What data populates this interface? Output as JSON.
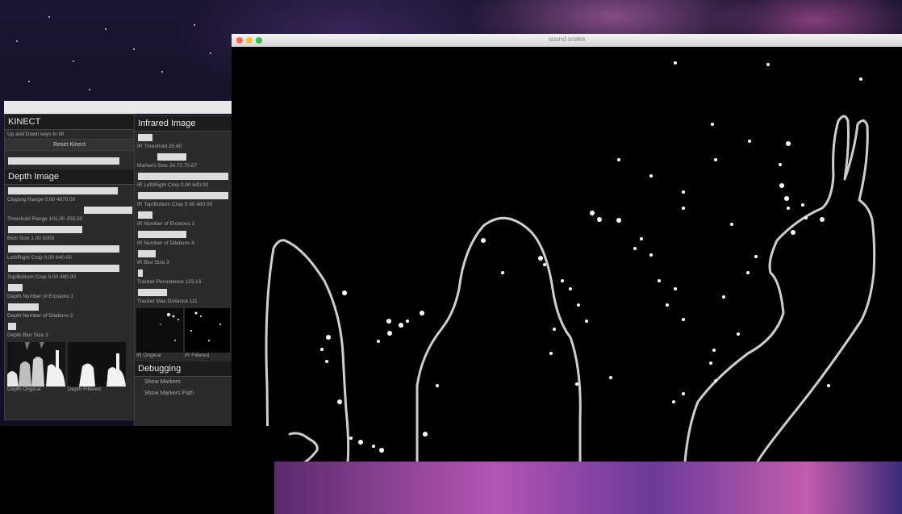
{
  "main_window": {
    "title": "sound snake",
    "traffic_colors": [
      "#ff5f57",
      "#febc2e",
      "#28c840"
    ]
  },
  "kinect_panel": {
    "header": "KINECT",
    "hint": "Up and Down keys to tilt",
    "reset_button": "Reset Kinect",
    "depth_section": "Depth Image",
    "rows": [
      "Clipping Range 0.00 4870.00",
      "Threshold Range 101.00 255.00",
      "Blob Size 1.00 5000",
      "Left/Right Crop 0.00 640.00",
      "Top/Bottom Crop 0.00 480.00",
      "Depth Number of Erosions 1",
      "Depth Number of Dilations 2",
      "Depth Blur Size 3"
    ],
    "thumb_labels": [
      "Depth Original",
      "Depth Filtered"
    ]
  },
  "infrared_panel": {
    "header": "Infrared Image",
    "rows": [
      "IR Threshold 35.40",
      "Markers Size 24.73 70.87",
      "IR Left/Right Crop 0.00 640.00",
      "IR Top/Bottom Crop 0.00 480.00",
      "IR Number of Erosions 1",
      "IR Number of Dilations 4",
      "IR Blur Size 3",
      "Tracker Persistence 133.14",
      "Tracker Max Distance 111"
    ],
    "thumb_labels": [
      "IR Original",
      "IR Filtered"
    ],
    "debugging_header": "Debugging",
    "debug_buttons": [
      "Show Markers",
      "Show Markers Path"
    ]
  }
}
